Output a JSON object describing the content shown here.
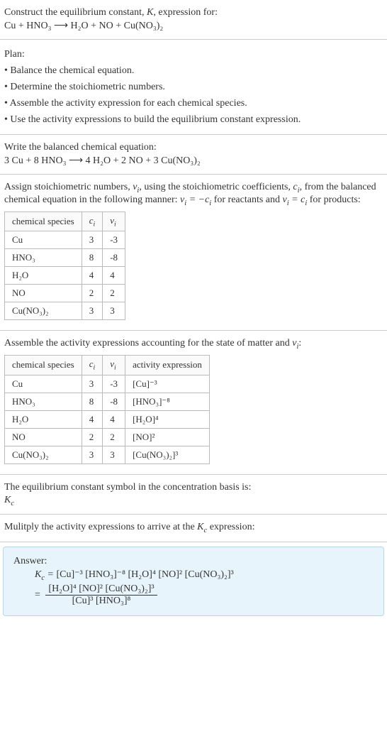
{
  "intro": {
    "line1": "Construct the equilibrium constant, K, expression for:",
    "equation": "Cu + HNO₃ ⟶ H₂O + NO + Cu(NO₃)₂"
  },
  "plan": {
    "heading": "Plan:",
    "items": [
      "Balance the chemical equation.",
      "Determine the stoichiometric numbers.",
      "Assemble the activity expression for each chemical species.",
      "Use the activity expressions to build the equilibrium constant expression."
    ]
  },
  "balanced": {
    "heading": "Write the balanced chemical equation:",
    "equation": "3 Cu + 8 HNO₃ ⟶ 4 H₂O + 2 NO + 3 Cu(NO₃)₂"
  },
  "stoich": {
    "heading_a": "Assign stoichiometric numbers, νᵢ, using the stoichiometric coefficients, cᵢ, from the balanced chemical equation in the following manner: νᵢ = −cᵢ for reactants and νᵢ = cᵢ for products:",
    "headers": [
      "chemical species",
      "cᵢ",
      "νᵢ"
    ],
    "rows": [
      {
        "species": "Cu",
        "c": "3",
        "v": "-3"
      },
      {
        "species": "HNO₃",
        "c": "8",
        "v": "-8"
      },
      {
        "species": "H₂O",
        "c": "4",
        "v": "4"
      },
      {
        "species": "NO",
        "c": "2",
        "v": "2"
      },
      {
        "species": "Cu(NO₃)₂",
        "c": "3",
        "v": "3"
      }
    ]
  },
  "activity": {
    "heading": "Assemble the activity expressions accounting for the state of matter and νᵢ:",
    "headers": [
      "chemical species",
      "cᵢ",
      "νᵢ",
      "activity expression"
    ],
    "rows": [
      {
        "species": "Cu",
        "c": "3",
        "v": "-3",
        "expr": "[Cu]⁻³"
      },
      {
        "species": "HNO₃",
        "c": "8",
        "v": "-8",
        "expr": "[HNO₃]⁻⁸"
      },
      {
        "species": "H₂O",
        "c": "4",
        "v": "4",
        "expr": "[H₂O]⁴"
      },
      {
        "species": "NO",
        "c": "2",
        "v": "2",
        "expr": "[NO]²"
      },
      {
        "species": "Cu(NO₃)₂",
        "c": "3",
        "v": "3",
        "expr": "[Cu(NO₃)₂]³"
      }
    ]
  },
  "symbol": {
    "line1": "The equilibrium constant symbol in the concentration basis is:",
    "line2": "K𝑐"
  },
  "multiply": {
    "heading": "Mulitply the activity expressions to arrive at the K𝑐 expression:"
  },
  "answer": {
    "label": "Answer:",
    "lhs": "K𝑐 = ",
    "flat": "[Cu]⁻³ [HNO₃]⁻⁸ [H₂O]⁴ [NO]² [Cu(NO₃)₂]³",
    "eq": "= ",
    "num": "[H₂O]⁴ [NO]² [Cu(NO₃)₂]³",
    "den": "[Cu]³ [HNO₃]⁸"
  }
}
